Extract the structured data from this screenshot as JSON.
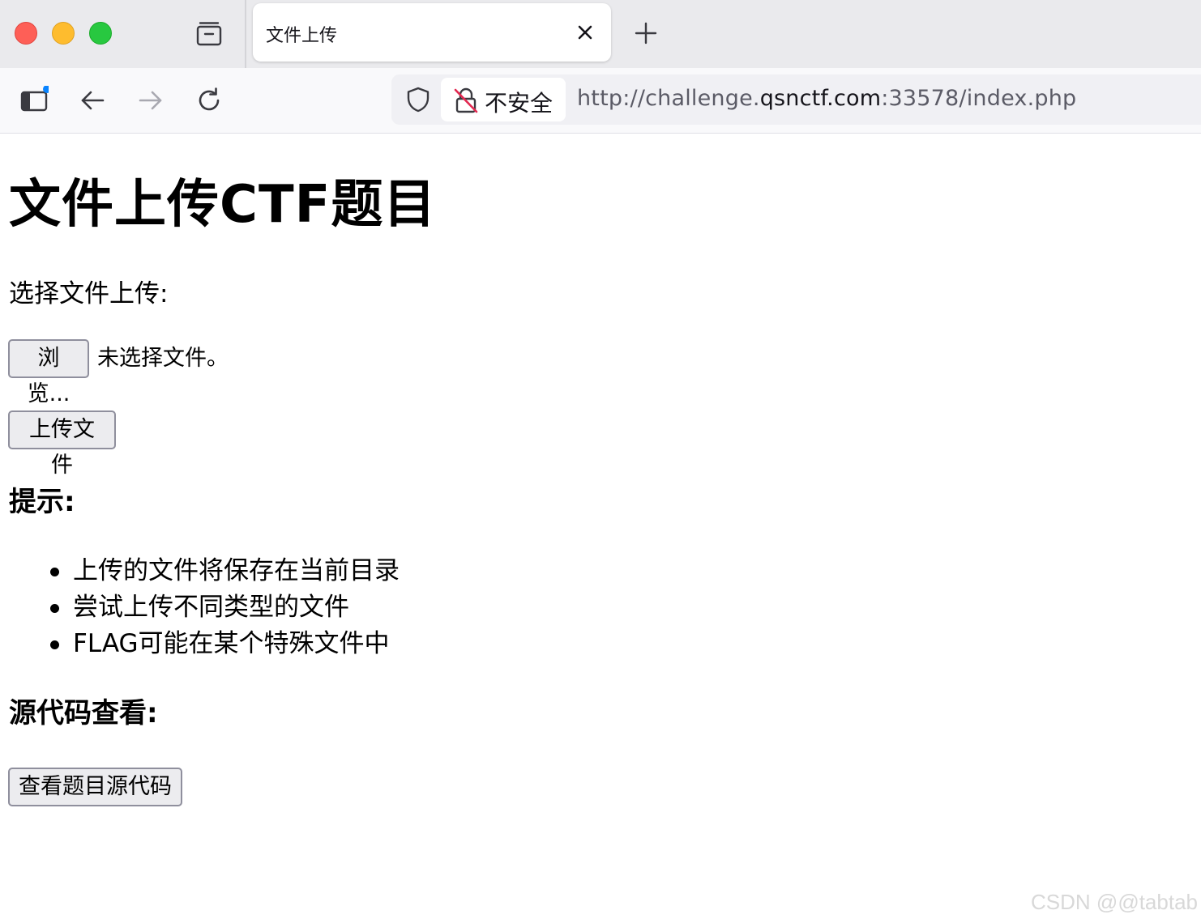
{
  "browser": {
    "tab": {
      "title": "文件上传"
    },
    "addressbar": {
      "security_label": "不安全",
      "url_prefix": "http://challenge.",
      "url_host": "qsnctf.com",
      "url_suffix": ":33578/index.php"
    },
    "colors": {
      "close": "#fe5f57",
      "minimize": "#febc2e",
      "zoom": "#28c840",
      "notification_dot": "#0a84ff",
      "insecure_slash": "#e22850"
    }
  },
  "page": {
    "title": "文件上传CTF题目",
    "choose_label": "选择文件上传:",
    "file_input": {
      "button_label": "浏览...",
      "status": "未选择文件。"
    },
    "upload_button": "上传文件",
    "tips_heading": "提示:",
    "tips": [
      "上传的文件将保存在当前目录",
      "尝试上传不同类型的文件",
      "FLAG可能在某个特殊文件中"
    ],
    "source_heading": "源代码查看:",
    "source_button": "查看题目源代码"
  },
  "watermark": "CSDN @@tabtab"
}
